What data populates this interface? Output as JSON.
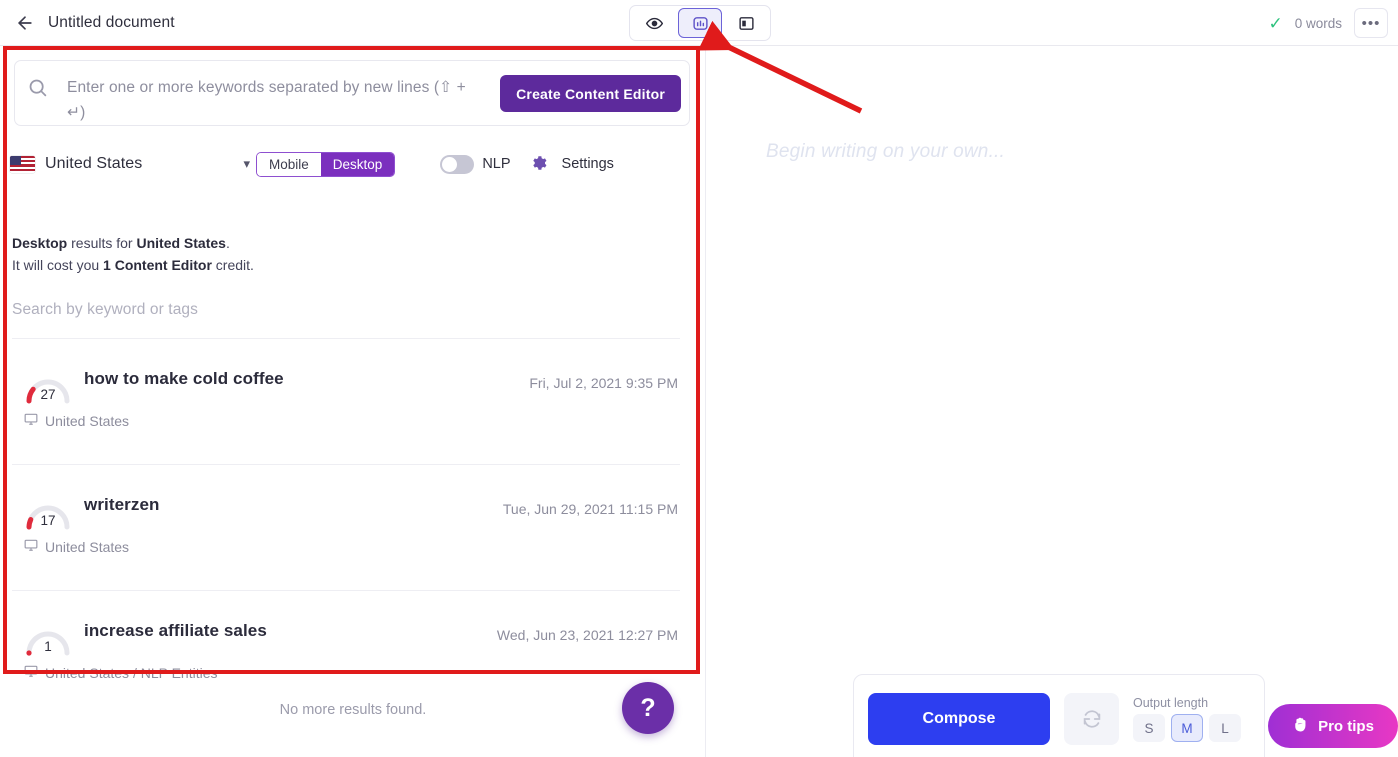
{
  "topbar": {
    "back_icon": "arrow-left-icon",
    "title": "Untitled document",
    "views": [
      {
        "id": "preview",
        "icon": "eye-icon",
        "active": false
      },
      {
        "id": "content-editor",
        "icon": "content-editor-icon",
        "active": true
      },
      {
        "id": "layout",
        "icon": "panel-layout-icon",
        "active": false
      }
    ],
    "saved_icon": "check-icon",
    "word_count": "0 words",
    "more_label": "•••"
  },
  "search": {
    "icon": "search-icon",
    "placeholder": "Enter one or more keywords separated by new lines (⇧ + ↵)",
    "value": "",
    "create_button": "Create Content Editor"
  },
  "controls": {
    "country": "United States",
    "country_flag": "us-flag-icon",
    "chevron": "chevron-down-icon",
    "device_options": [
      "Mobile",
      "Desktop"
    ],
    "device_selected": "Desktop",
    "nlp_label": "NLP",
    "nlp_enabled": false,
    "gear_icon": "gear-icon",
    "settings_label": "Settings"
  },
  "info": {
    "line1_prefix": "",
    "line1_bold1": "Desktop",
    "line1_mid": " results for ",
    "line1_bold2": "United States",
    "line1_suffix": ".",
    "line2_prefix": "It will cost you ",
    "line2_bold": "1 Content Editor",
    "line2_suffix": " credit."
  },
  "tag_search": {
    "placeholder": "Search by keyword or tags",
    "value": ""
  },
  "results": [
    {
      "score": "27",
      "score_pct": 27,
      "title": "how to make cold coffee",
      "date": "Fri, Jul 2, 2021 9:35 PM",
      "meta_icon": "desktop-icon",
      "meta": "United States"
    },
    {
      "score": "17",
      "score_pct": 17,
      "title": "writerzen",
      "date": "Tue, Jun 29, 2021 11:15 PM",
      "meta_icon": "desktop-icon",
      "meta": "United States"
    },
    {
      "score": "1",
      "score_pct": 1,
      "title": "increase affiliate sales",
      "date": "Wed, Jun 23, 2021 12:27 PM",
      "meta_icon": "desktop-icon",
      "meta": "United States / NLP Entities"
    }
  ],
  "footer": {
    "no_more": "No more results found.",
    "help_icon": "question-mark-icon"
  },
  "editor": {
    "placeholder": "Begin writing on your own..."
  },
  "compose": {
    "button": "Compose",
    "regenerate_icon": "refresh-icon",
    "output_length_label": "Output length",
    "lengths": [
      "S",
      "M",
      "L"
    ],
    "length_selected": "M"
  },
  "protips": {
    "icon": "hand-icon",
    "label": "Pro tips"
  },
  "annotation": {
    "box_color": "#e01b1b",
    "arrow_color": "#e01b1b"
  },
  "colors": {
    "primary_purple": "#5d2a9c",
    "accent_purple": "#7b2fbe",
    "compose_blue": "#2d3ef0",
    "gauge_red": "#e02b3c",
    "check_green": "#2ec27e"
  }
}
